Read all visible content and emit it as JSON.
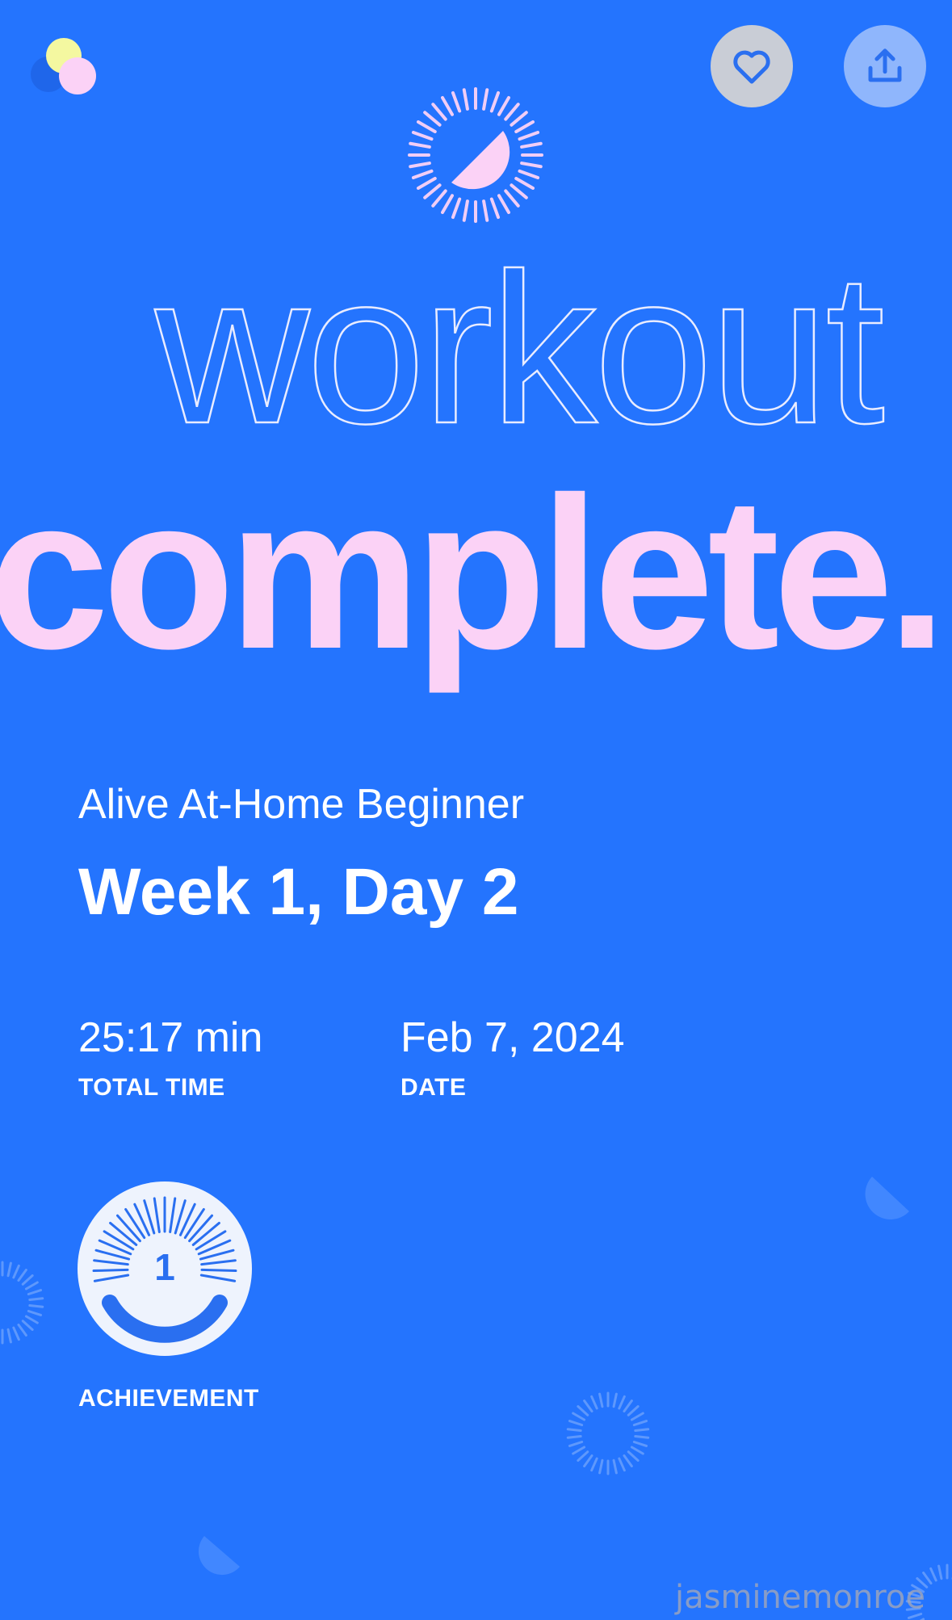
{
  "header": {
    "logo_icon": "app-logo-icon",
    "favorite_icon": "heart-icon",
    "share_icon": "share-upload-icon"
  },
  "hero": {
    "icon": "sun-half-icon",
    "title_outline": "workout",
    "title_fill": "complete."
  },
  "workout": {
    "program": "Alive At-Home Beginner",
    "session": "Week 1, Day 2"
  },
  "stats": {
    "total_time_value": "25:17 min",
    "total_time_label": "TOTAL TIME",
    "date_value": "Feb 7, 2024",
    "date_label": "DATE"
  },
  "achievement": {
    "number": "1",
    "label": "ACHIEVEMENT",
    "icon": "achievement-badge-icon"
  },
  "watermark": "jasminemonroe",
  "colors": {
    "background": "#2474fe",
    "accent_pink": "#fbd2f6",
    "logo_yellow": "#f4f8a0",
    "outline_text": "#e9ecff"
  }
}
